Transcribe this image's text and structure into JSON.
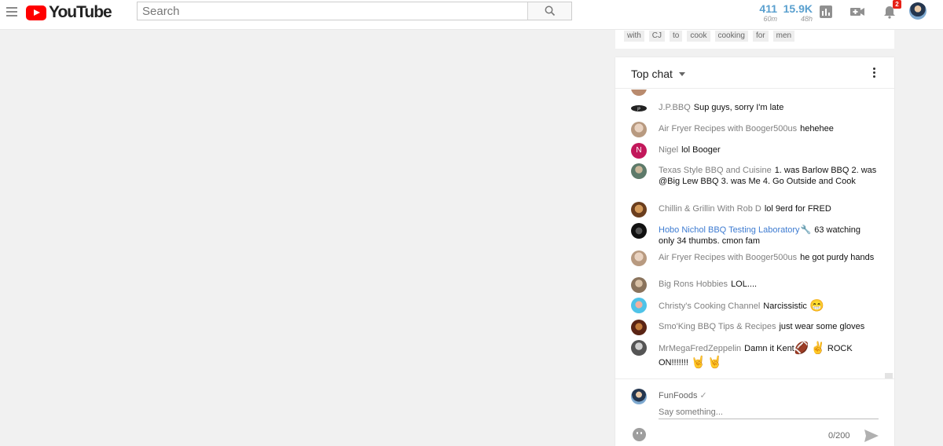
{
  "header": {
    "logo_text": "YouTube",
    "search_placeholder": "Search",
    "stats": [
      {
        "value": "411",
        "period": "60m"
      },
      {
        "value": "15.9K",
        "period": "48h"
      }
    ],
    "notification_count": "2",
    "icons": [
      "menu-icon",
      "search-icon",
      "analytics-icon",
      "upload-video-icon",
      "notifications-bell-icon"
    ]
  },
  "tags": [
    "with",
    "CJ",
    "to",
    "cook",
    "cooking",
    "for",
    "men"
  ],
  "chat": {
    "title": "Top chat",
    "messages": [
      {
        "author": "J.P.BBQ",
        "text": "Sup guys, sorry I'm late",
        "color": "#2b2b2b"
      },
      {
        "author": "Air Fryer Recipes with Booger500us",
        "text": "hehehee",
        "color": "#c9b3a0"
      },
      {
        "author": "Nigel",
        "text": "lol Booger",
        "color": "#c2185b",
        "initial": "N"
      },
      {
        "author": "Texas Style BBQ and Cuisine",
        "text": "1. was Barlow BBQ 2. was @Big Lew BBQ 3. was Me 4. Go Outside and Cook",
        "color": "#8a9a8a"
      },
      {
        "author": "Chillin & Grillin With Rob D",
        "text": "lol 9erd for FRED",
        "color": "#8b5a2b"
      },
      {
        "author": "Hobo Nichol BBQ Testing Laboratory",
        "text": "63 watching only 34 thumbs. cmon fam",
        "color": "#1a1a1a"
      },
      {
        "author": "Air Fryer Recipes with Booger500us",
        "text": "he got purdy hands",
        "color": "#c9b3a0"
      },
      {
        "author": "Big Rons Hobbies",
        "text": "LOL....",
        "color": "#a08870"
      },
      {
        "author": "Christy's Cooking Channel",
        "text": "Narcissistic",
        "color": "#4fc3e8"
      },
      {
        "author": "Smo'King BBQ Tips & Recipes",
        "text": "just wear some gloves",
        "color": "#6b2a1a"
      },
      {
        "author": "MrMegaFredZeppelin",
        "text_a": "Damn it Kent",
        "text_b": "ROCK ON!!!!!!!",
        "color": "#6a6a6a"
      }
    ],
    "input": {
      "user": "FunFoods",
      "placeholder": "Say something...",
      "counter": "0/200"
    }
  }
}
